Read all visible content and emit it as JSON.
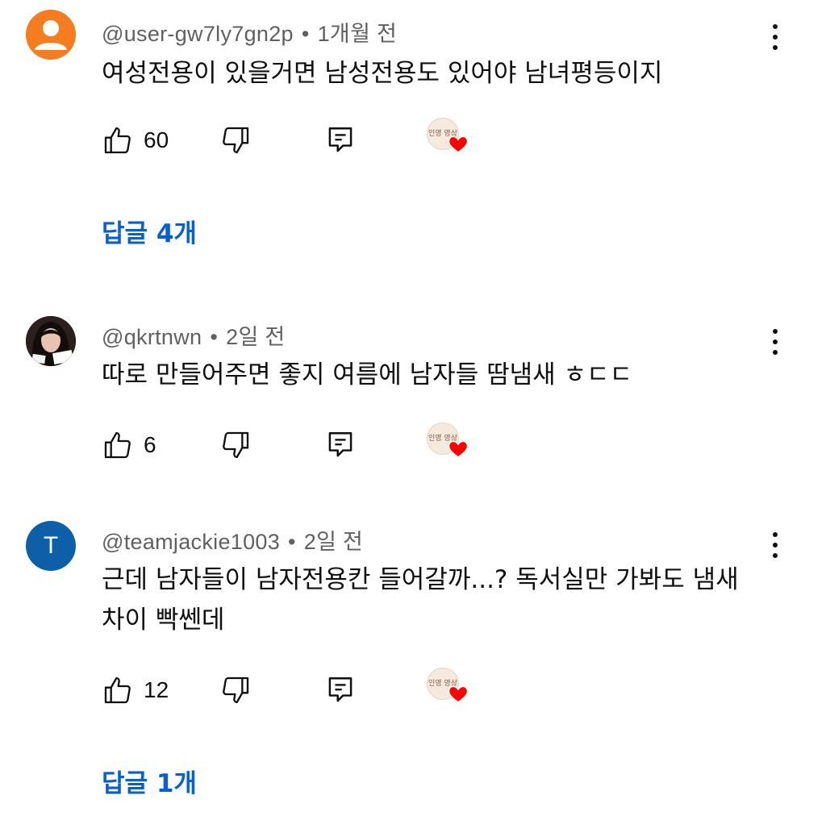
{
  "comments": [
    {
      "handle": "@user-gw7ly7gn2p",
      "time": "1개월 전",
      "text": "여성전용이 있을거면 남성전용도 있어야 남녀평등이지",
      "likes": "60",
      "replies": "답글 4개",
      "avatar": "default-person-icon"
    },
    {
      "handle": "@qkrtnwn",
      "time": "2일 전",
      "text": "따로 만들어주면 좋지 여름에 남자들 땀냄새 ㅎㄷㄷ",
      "likes": "6",
      "avatar": "photo"
    },
    {
      "handle": "@teamjackie1003",
      "time": "2일 전",
      "text": "근데 남자들이 남자전용칸 들어갈까...? 독서실만 가봐도 냄새차이 빡쎈데",
      "likes": "12",
      "replies": "답글 1개",
      "avatar_letter": "T"
    }
  ],
  "creator_badge": {
    "text": "인영 영상",
    "heart_color": "#ff0000"
  },
  "colors": {
    "link": "#065fd4",
    "meta": "#606060",
    "orange_avatar": "#f57c1f",
    "blue_avatar": "#0d60a8"
  }
}
